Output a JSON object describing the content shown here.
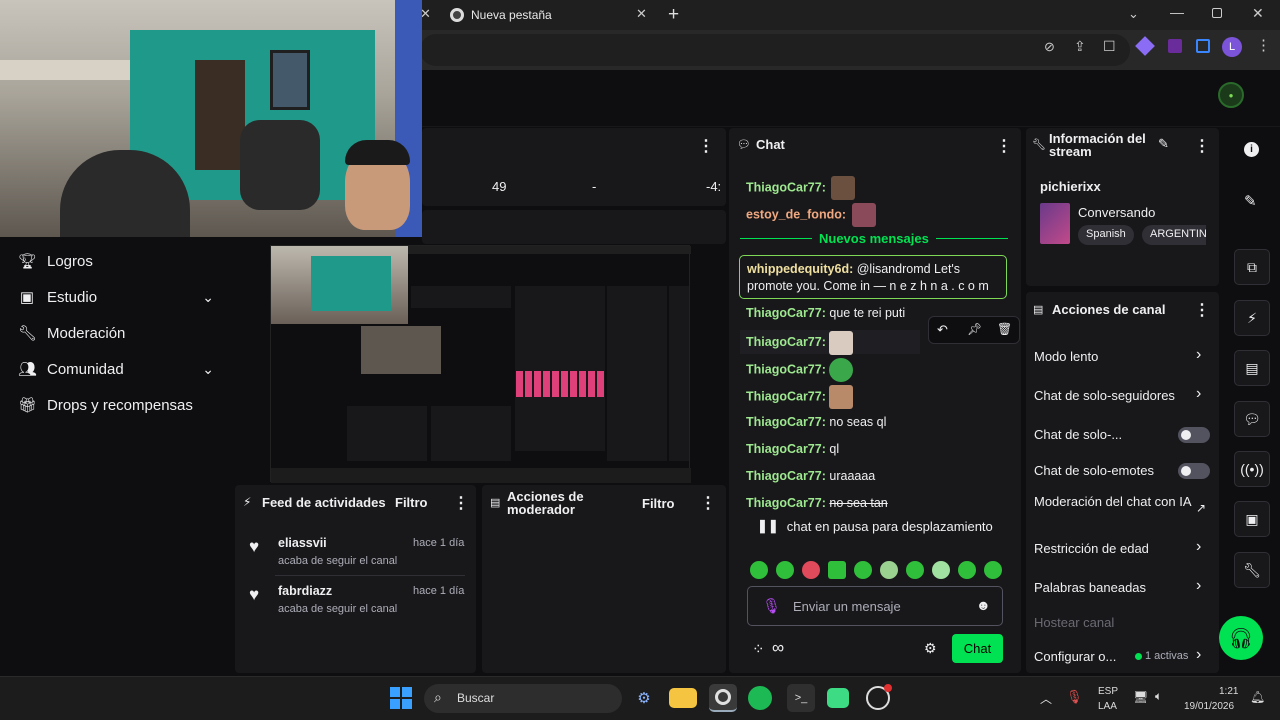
{
  "browser": {
    "tab_title": "Nueva pestaña",
    "profile_initial": "L"
  },
  "stats": {
    "followers": "49",
    "dash": "-",
    "time": "-4:"
  },
  "nav": [
    {
      "label": "Logros",
      "icon": "trophy-icon"
    },
    {
      "label": "Estudio",
      "icon": "studio-icon",
      "has_chevron": true
    },
    {
      "label": "Moderación",
      "icon": "wrench-icon"
    },
    {
      "label": "Comunidad",
      "icon": "people-icon",
      "has_chevron": true
    },
    {
      "label": "Drops y recompensas",
      "icon": "gift-icon"
    }
  ],
  "activity_feed": {
    "title": "Feed de actividades",
    "filter": "Filtro",
    "items": [
      {
        "user": "eliassvii",
        "action": "acaba de seguir el canal",
        "time": "hace 1 día"
      },
      {
        "user": "fabrdiazz",
        "action": "acaba de seguir el canal",
        "time": "hace 1 día"
      }
    ]
  },
  "mod_actions": {
    "title": "Acciones de moderador",
    "filter": "Filtro"
  },
  "chat": {
    "title": "Chat",
    "new_messages": "Nuevos mensajes",
    "messages": [
      {
        "user": "ThiagoCar77:",
        "text": ""
      },
      {
        "user": "estoy_de_fondo:",
        "text": ""
      },
      {
        "user": "whippedequity6d:",
        "text": "@lisandromd Let's promote you. Come in — n e z h n a . c o m"
      },
      {
        "user": "ThiagoCar77:",
        "text": "que te rei puti"
      },
      {
        "user": "ThiagoCar77:",
        "text": ""
      },
      {
        "user": "ThiagoCar77:",
        "text": ""
      },
      {
        "user": "ThiagoCar77:",
        "text": ""
      },
      {
        "user": "ThiagoCar77:",
        "text": "no seas ql"
      },
      {
        "user": "ThiagoCar77:",
        "text": "ql"
      },
      {
        "user": "ThiagoCar77:",
        "text": "uraaaaa"
      },
      {
        "user": "ThiagoCar77:",
        "text": "no sea tan"
      }
    ],
    "paused": "chat en pausa para desplazamiento",
    "input_placeholder": "Enviar un mensaje",
    "send_label": "Chat"
  },
  "stream_info": {
    "title": "Información del stream",
    "channel": "pichierixx",
    "category": "Conversando",
    "tags": [
      "Spanish",
      "ARGENTINA"
    ]
  },
  "channel_actions": {
    "title": "Acciones de canal",
    "items": [
      {
        "label": "Modo lento",
        "control": "chevron"
      },
      {
        "label": "Chat de solo-seguidores",
        "control": "chevron"
      },
      {
        "label": "Chat de solo-...",
        "control": "toggle"
      },
      {
        "label": "Chat de solo-emotes",
        "control": "toggle"
      },
      {
        "label": "Moderación del chat con IA",
        "control": "external"
      },
      {
        "label": "Restricción de edad",
        "control": "chevron"
      },
      {
        "label": "Palabras baneadas",
        "control": "chevron"
      },
      {
        "label": "Hostear canal",
        "control": "none"
      },
      {
        "label": "Configurar o...",
        "control": "chevron",
        "badge": "1 activas"
      }
    ]
  },
  "taskbar": {
    "search": "Buscar",
    "lang1": "ESP",
    "lang2": "LAA",
    "time": "1:21",
    "date": "19/01/2026"
  },
  "colors": {
    "accent": "#00e251",
    "chat_user": "#9ee88f",
    "highlight_border": "#7ed957"
  }
}
